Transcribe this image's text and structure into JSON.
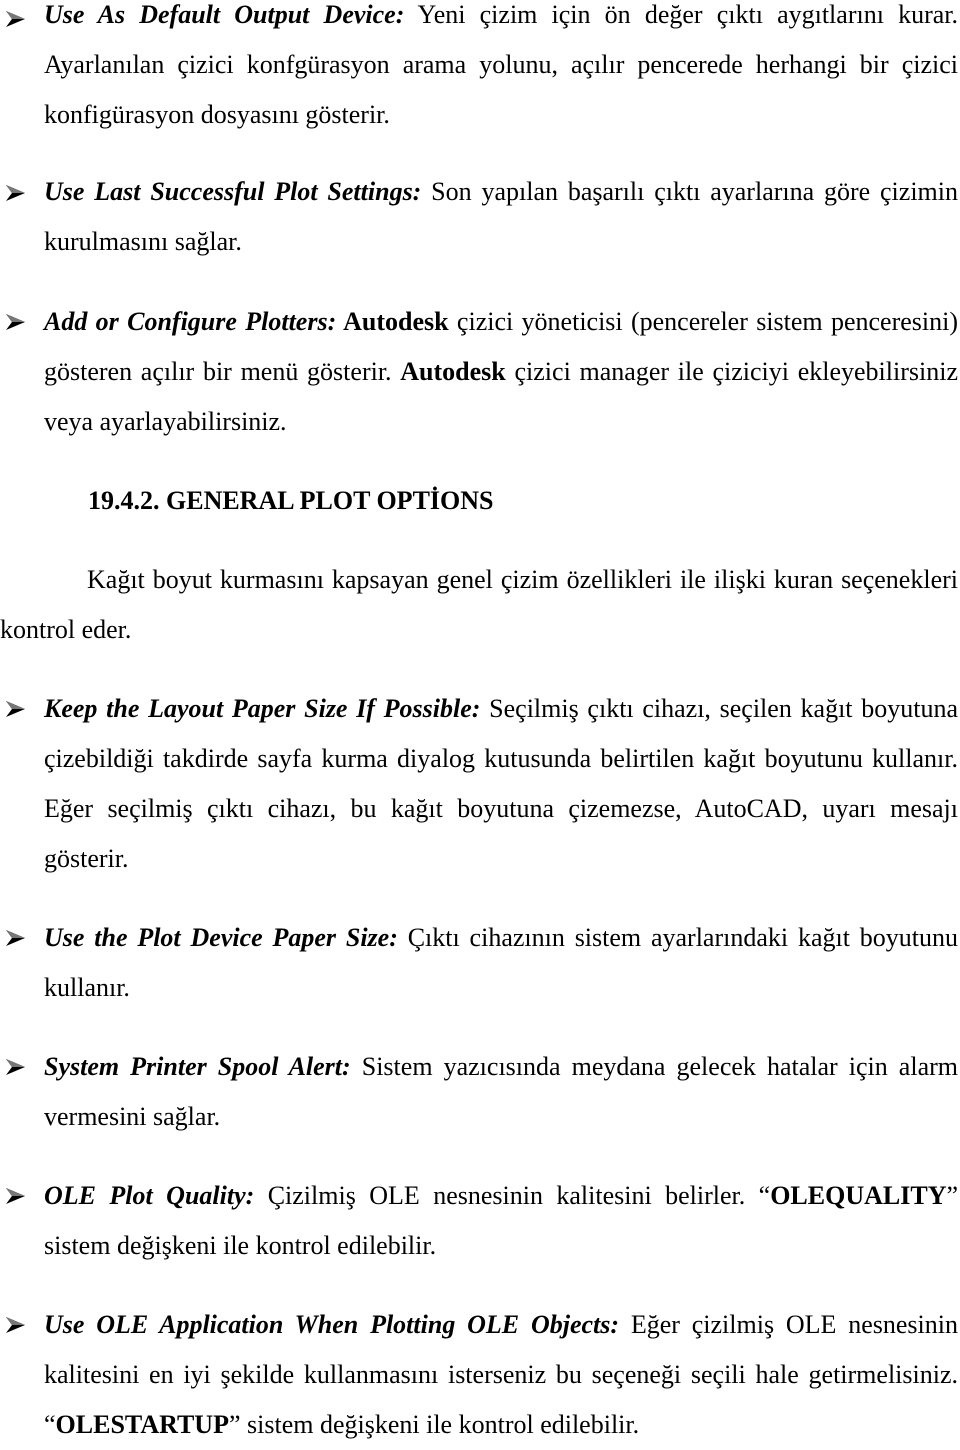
{
  "items_top": [
    {
      "term": "Use As Default Output Device:",
      "text": " Yeni çizim için ön değer çıktı aygıtlarını kurar. Ayarlanılan çizici konfgürasyon arama yolunu, açılır pencerede herhangi bir çizici konfigürasyon dosyasını gösterir."
    },
    {
      "term": "Use Last Successful Plot Settings:",
      "text": " Son yapılan başarılı çıktı ayarlarına göre çizimin kurulmasını sağlar."
    },
    {
      "term": "Add or Configure Plotters:",
      "bold1": " Autodesk",
      "text1": " çizici yöneticisi (pencereler sistem penceresini)  gösteren açılır bir menü gösterir. ",
      "bold2": "Autodesk",
      "text2": " çizici manager ile çiziciyi  ekleyebilirsiniz veya  ayarlayabilirsiniz."
    }
  ],
  "section": {
    "heading": "19.4.2. GENERAL PLOT OPTİONS",
    "intro": "Kağıt boyut kurmasını  kapsayan genel çizim özellikleri ile  ilişki kuran seçenekleri  kontrol eder."
  },
  "items_bottom": [
    {
      "term": "Keep the Layout Paper Size If Possible:",
      "text": " Seçilmiş çıktı cihazı, seçilen kağıt boyutuna  çizebildiği takdirde sayfa kurma  diyalog kutusunda belirtilen kağıt boyutunu  kullanır. Eğer seçilmiş çıktı cihazı, bu kağıt boyutuna  çizemezse, AutoCAD, uyarı  mesajı  gösterir."
    },
    {
      "term": "Use the Plot Device Paper Size:",
      "text": " Çıktı cihazının sistem ayarlarındaki kağıt boyutunu kullanır."
    },
    {
      "term": "System Printer Spool Alert:",
      "text": " Sistem yazıcısında meydana gelecek hatalar için alarm vermesini sağlar."
    },
    {
      "term": "OLE Plot Quality:",
      "text1": " Çizilmiş OLE nesnesinin kalitesini belirler. “",
      "bold": "OLEQUALITY",
      "text2": "” sistem değişkeni ile kontrol edilebilir."
    },
    {
      "term": "Use OLE Application When Plotting OLE Objects:",
      "text1": " Eğer çizilmiş OLE nesnesinin  kalitesini en iyi şekilde kullanmasını  isterseniz bu seçeneği seçili hale getirmelisiniz. “",
      "bold": "OLESTARTUP",
      "text2": "” sistem değişkeni ile kontrol edilebilir."
    }
  ],
  "bullet_icon": "arrowhead-bullet-icon"
}
